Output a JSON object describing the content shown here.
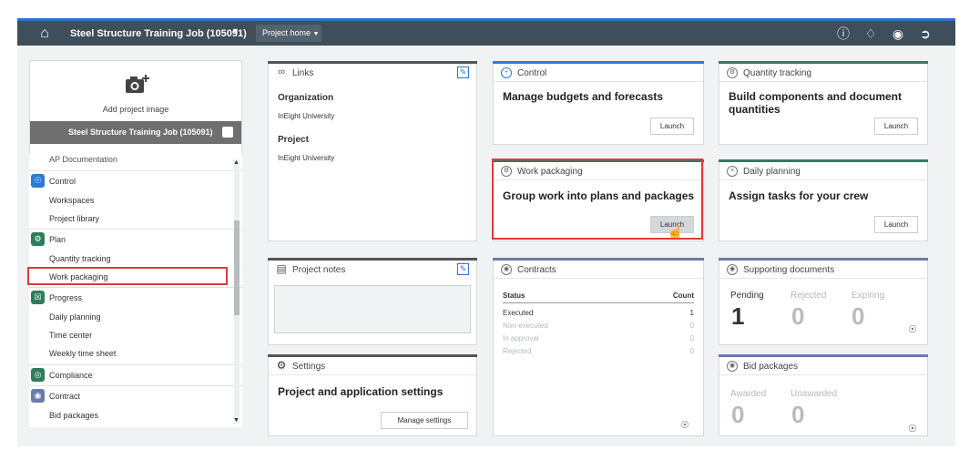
{
  "topbar": {
    "job_title": "Steel Structure Training Job (105091)",
    "project_home_label": "Project home"
  },
  "sidebar": {
    "add_image_label": "Add project image",
    "project_name": "Steel Structure Training Job (105091)",
    "cut_item": "AP Documentation",
    "groups": [
      {
        "label": "Control",
        "color": "#2b7bd6",
        "items": [
          "Workspaces",
          "Project library"
        ]
      },
      {
        "label": "Plan",
        "color": "#2e7d5b",
        "items": [
          "Quantity tracking",
          "Work packaging"
        ]
      },
      {
        "label": "Progress",
        "color": "#2e7d5b",
        "items": [
          "Daily planning",
          "Time center",
          "Weekly time sheet"
        ]
      },
      {
        "label": "Compliance",
        "color": "#2e7d5b",
        "items": []
      },
      {
        "label": "Contract",
        "color": "#6b7ba8",
        "items": [
          "Bid packages"
        ]
      }
    ]
  },
  "tiles": {
    "links": {
      "title": "Links",
      "org_heading": "Organization",
      "org_value": "InEight University",
      "project_heading": "Project",
      "project_value": "InEight University"
    },
    "notes": {
      "title": "Project notes"
    },
    "settings": {
      "title": "Settings",
      "big_text": "Project and application settings",
      "button": "Manage settings"
    },
    "control": {
      "title": "Control",
      "big_text": "Manage budgets and forecasts",
      "button": "Launch"
    },
    "work_packaging": {
      "title": "Work packaging",
      "big_text": "Group work into plans and packages",
      "button": "Launch"
    },
    "contracts": {
      "title": "Contracts",
      "status_header": "Status",
      "count_header": "Count",
      "rows": [
        {
          "status": "Executed",
          "count": "1"
        },
        {
          "status": "Non-executed",
          "count": "0"
        },
        {
          "status": "In approval",
          "count": "0"
        },
        {
          "status": "Rejected",
          "count": "0"
        }
      ]
    },
    "quantity_tracking": {
      "title": "Quantity tracking",
      "big_text": "Build components and document quantities",
      "button": "Launch"
    },
    "daily_planning": {
      "title": "Daily planning",
      "big_text": "Assign tasks for your crew",
      "button": "Launch"
    },
    "supporting_docs": {
      "title": "Supporting documents",
      "labels": [
        "Pending",
        "Rejected",
        "Expiring"
      ],
      "values": [
        "1",
        "0",
        "0"
      ]
    },
    "bid_packages": {
      "title": "Bid packages",
      "labels": [
        "Awarded",
        "Unawarded"
      ],
      "values": [
        "0",
        "0"
      ]
    }
  },
  "colors": {
    "topbar": "#3e4e5a",
    "accent_blue": "#2d6fd6",
    "green": "#2e7d5b",
    "highlight_red": "#e03a3a"
  }
}
